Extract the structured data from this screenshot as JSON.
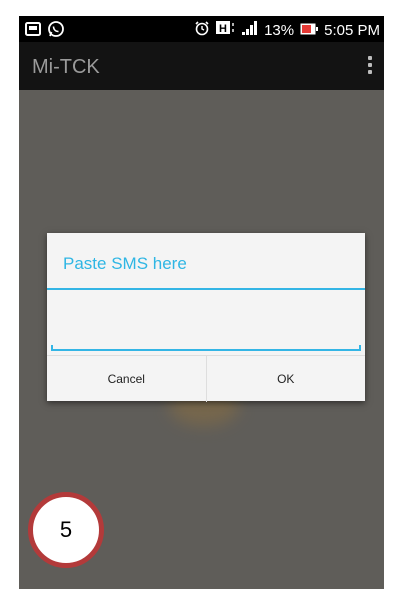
{
  "status_bar": {
    "icons": [
      "gallery-icon",
      "whatsapp-icon",
      "alarm-icon",
      "h-signal-icon",
      "signal-bars-icon",
      "battery-icon"
    ],
    "battery": "13%",
    "time": "5:05 PM",
    "battery_color": "#e53935"
  },
  "action_bar": {
    "title": "Mi-TCK",
    "menu_icon": "overflow-menu-icon"
  },
  "dialog": {
    "title": "Paste SMS here",
    "input_value": "",
    "cancel_label": "Cancel",
    "ok_label": "OK",
    "accent_color": "#33b5e5"
  },
  "step_badge": {
    "label": "5",
    "border_color": "#b33a3a"
  }
}
